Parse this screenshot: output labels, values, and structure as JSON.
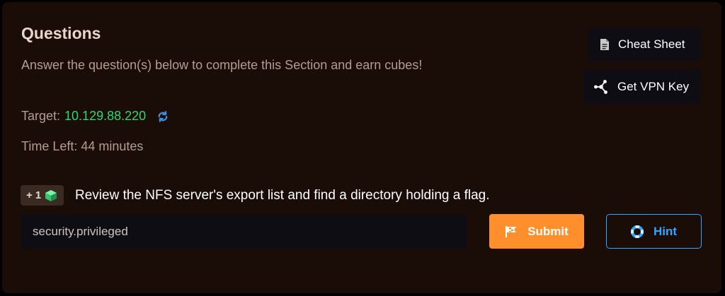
{
  "section": {
    "title": "Questions",
    "subtitle": "Answer the question(s) below to complete this Section and earn cubes!",
    "target_label": "Target:",
    "target_ip": "10.129.88.220",
    "time_left": "Time Left: 44 minutes"
  },
  "buttons": {
    "cheat_sheet": "Cheat Sheet",
    "vpn_key": "Get VPN Key",
    "submit": "Submit",
    "hint": "Hint"
  },
  "question": {
    "reward": "+ 1",
    "text": "Review the NFS server's export list and find a directory holding a flag.",
    "answer_value": "security.privileged"
  },
  "icons": {
    "cheat_sheet": "document-icon",
    "vpn_key": "network-nodes-icon",
    "refresh": "refresh-icon",
    "reward": "cube-icon",
    "submit": "flag-icon",
    "hint": "lifebuoy-icon"
  },
  "colors": {
    "background": "#1a0c07",
    "accent_orange": "#ff8f2c",
    "accent_blue": "#2fa6ff",
    "target_green": "#2fd86c"
  }
}
